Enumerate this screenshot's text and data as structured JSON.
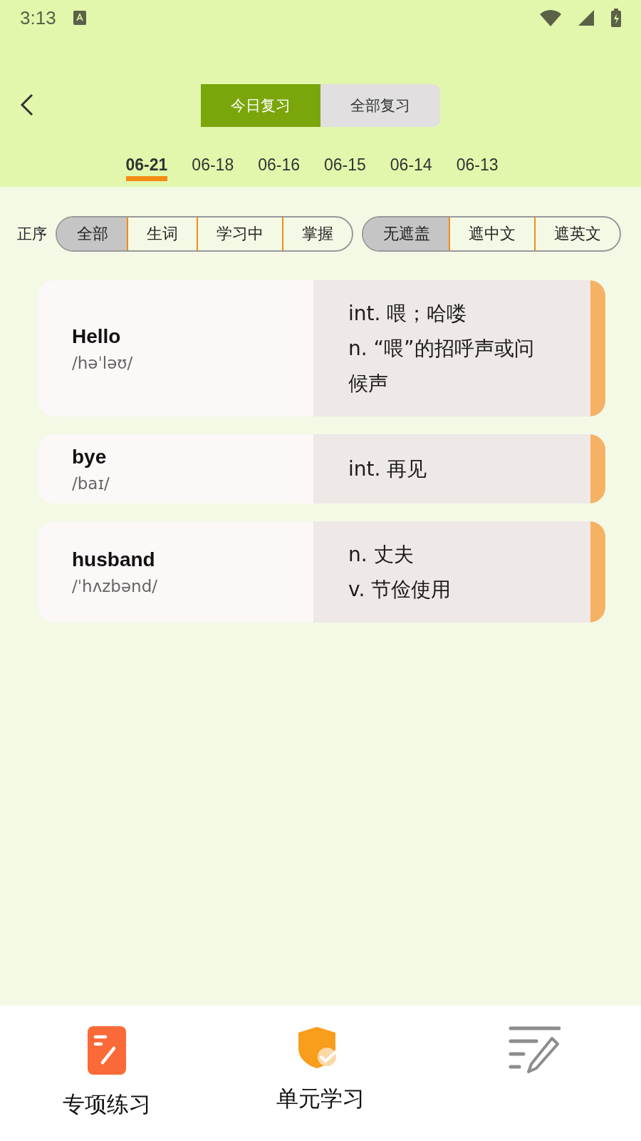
{
  "status_bar": {
    "time": "3:13"
  },
  "mode_tabs": [
    {
      "label": "今日复习",
      "selected": true
    },
    {
      "label": "全部复习",
      "selected": false
    }
  ],
  "date_tabs": [
    {
      "label": "06-21",
      "selected": true
    },
    {
      "label": "06-18",
      "selected": false
    },
    {
      "label": "06-16",
      "selected": false
    },
    {
      "label": "06-15",
      "selected": false
    },
    {
      "label": "06-14",
      "selected": false
    },
    {
      "label": "06-13",
      "selected": false
    }
  ],
  "sort_label": "正序",
  "filter_groups": [
    [
      {
        "label": "全部",
        "selected": true
      },
      {
        "label": "生词",
        "selected": false
      },
      {
        "label": "学习中",
        "selected": false
      },
      {
        "label": "掌握",
        "selected": false
      }
    ],
    [
      {
        "label": "无遮盖",
        "selected": true
      },
      {
        "label": "遮中文",
        "selected": false
      },
      {
        "label": "遮英文",
        "selected": false
      }
    ]
  ],
  "words": [
    {
      "word": "Hello",
      "phonetic": "/həˈləʊ/",
      "meanings": [
        "int. 喂；哈喽",
        "n. “喂”的招呼声或问候声"
      ]
    },
    {
      "word": "bye",
      "phonetic": "/baɪ/",
      "meanings": [
        "int. 再见"
      ]
    },
    {
      "word": "husband",
      "phonetic": "/ˈhʌzbənd/",
      "meanings": [
        "n. 丈夫",
        "v. 节俭使用"
      ]
    }
  ],
  "bottom_nav": [
    {
      "kind": "practice",
      "label": "专项练习"
    },
    {
      "kind": "unit",
      "label": "单元学习"
    },
    {
      "kind": "dictation"
    }
  ]
}
